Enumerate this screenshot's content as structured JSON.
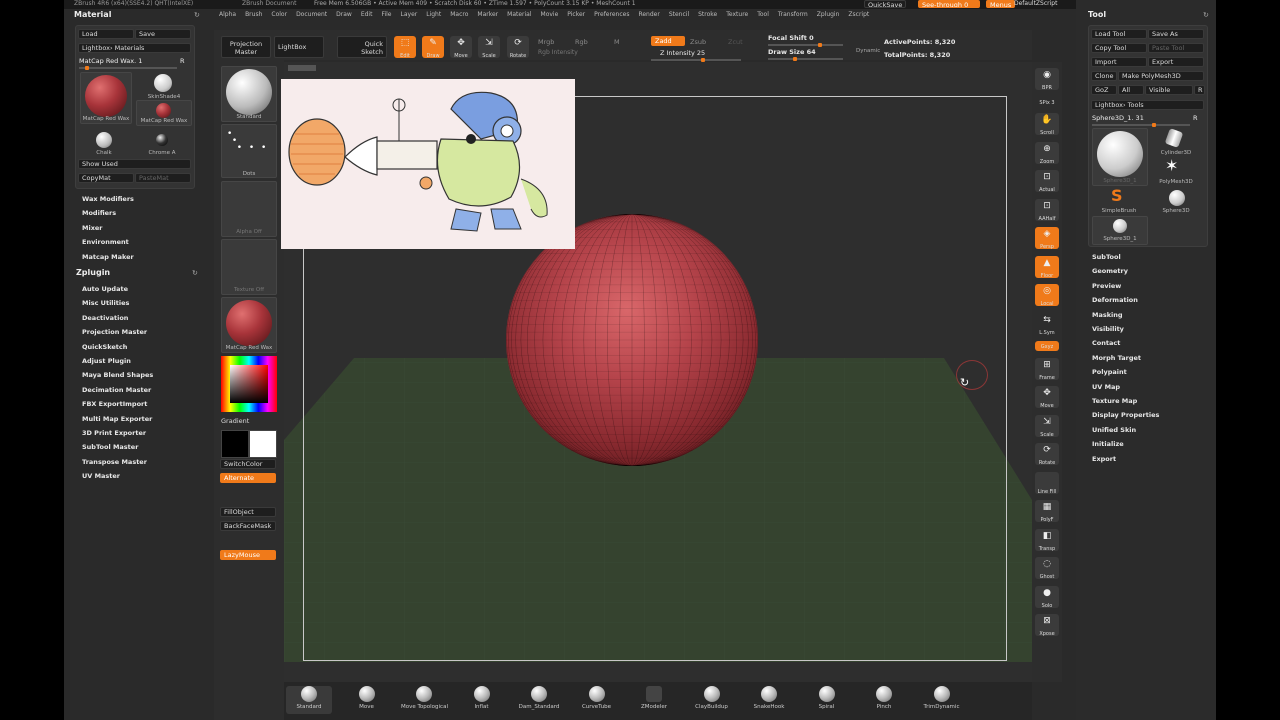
{
  "window": {
    "title_left": "ZBrush 4R6 (x64)(SSE4.2) QHT(IntelXE)",
    "doc": "ZBrush Document",
    "stats": "Free Mem 6.506GB • Active Mem 409 • Scratch Disk 60 • ZTime 1.597 • PolyCount 3.15 KP • MeshCount 1",
    "quicksave": "QuickSave",
    "see_through": "See-through 0",
    "menus": "Menus",
    "script": "DefaultZScript"
  },
  "menubar": [
    "Alpha",
    "Brush",
    "Color",
    "Document",
    "Draw",
    "Edit",
    "File",
    "Layer",
    "Light",
    "Macro",
    "Marker",
    "Material",
    "Movie",
    "Picker",
    "Preferences",
    "Render",
    "Stencil",
    "Stroke",
    "Texture",
    "Tool",
    "Transform",
    "Zplugin",
    "Zscript"
  ],
  "material_panel": {
    "title": "Material",
    "load": "Load",
    "save": "Save",
    "lightbox": "Lightbox› Materials",
    "current": "MatCap Red Wax. 1",
    "r": "R",
    "mat1": "MatCap Red Wax",
    "mat2": "SkinShade4",
    "mat3": "MatCap Red Wax",
    "mat4": "Chalk",
    "mat5": "Chrome A",
    "show_used": "Show Used",
    "copy": "CopyMat",
    "paste": "PasteMat"
  },
  "left_menu": [
    "Wax Modifiers",
    "Modifiers",
    "Mixer",
    "Environment",
    "Matcap Maker"
  ],
  "zplugin": {
    "title": "Zplugin",
    "items": [
      "Auto Update",
      "Misc Utilities",
      "Deactivation",
      "Projection Master",
      "QuickSketch",
      "Adjust Plugin",
      "Maya Blend Shapes",
      "Decimation Master",
      "FBX ExportImport",
      "Multi Map Exporter",
      "3D Print Exporter",
      "SubTool Master",
      "Transpose Master",
      "UV Master"
    ]
  },
  "left_shelf": {
    "standard": "Standard",
    "dots": "Dots",
    "alpha": "Alpha Off",
    "texture": "Texture Off",
    "material": "MatCap Red Wax",
    "gradient": "Gradient",
    "switch": "SwitchColor",
    "alternate": "Alternate",
    "fill": "FillObject",
    "backface": "BackFaceMask",
    "lazy": "LazyMouse"
  },
  "top_shelf": {
    "projection": "Projection Master",
    "lightbox": "LightBox",
    "quick": "Quick Sketch",
    "edit": "Edit",
    "draw": "Draw",
    "move": "Move",
    "scale": "Scale",
    "rotate": "Rotate",
    "mrgb": "Mrgb",
    "rgb": "Rgb",
    "m": "M",
    "rgb_intensity": "Rgb Intensity",
    "zadd": "Zadd",
    "zsub": "Zsub",
    "zcut": "Zcut",
    "z_intensity": "Z Intensity",
    "z_intensity_val": "25",
    "focal": "Focal Shift",
    "focal_val": "0",
    "draw_size": "Draw Size",
    "draw_size_val": "64",
    "dynamic": "Dynamic",
    "active_points": "ActivePoints: 8,320",
    "total_points": "TotalPoints: 8,320"
  },
  "right_shelf": [
    "BPR",
    "SPix 3",
    "Scroll",
    "Zoom",
    "Actual",
    "AAHalf",
    "Persp",
    "Floor",
    "Local",
    "L.Sym",
    "Gxyz",
    "Frame",
    "Move",
    "Scale",
    "Rotate",
    "Line Fill",
    "PolyF",
    "Transp",
    "Ghost",
    "Solo",
    "Xpose"
  ],
  "tool_panel": {
    "title": "Tool",
    "load": "Load Tool",
    "save": "Save As",
    "copy": "Copy Tool",
    "paste": "Paste Tool",
    "import": "Import",
    "export": "Export",
    "clone": "Clone",
    "make": "Make PolyMesh3D",
    "goz": "GoZ",
    "all": "All",
    "visible": "Visible",
    "r": "R",
    "lightbox": "Lightbox› Tools",
    "current": "Sphere3D_1. 31",
    "r2": "R",
    "t1": "Sphere3D_1",
    "t2": "Cylinder3D",
    "t3": "PolyMesh3D",
    "t4": "SimpleBrush",
    "t5": "Sphere3D",
    "t6": "Sphere3D_1"
  },
  "tool_menu": [
    "SubTool",
    "Geometry",
    "Preview",
    "Deformation",
    "Masking",
    "Visibility",
    "Contact",
    "Morph Target",
    "Polypaint",
    "UV Map",
    "Texture Map",
    "Display Properties",
    "Unified Skin",
    "Initialize",
    "Export"
  ],
  "brushes": [
    "Standard",
    "Move",
    "Move Topological",
    "Inflat",
    "Dam_Standard",
    "CurveTube",
    "ZModeler",
    "ClayBuildup",
    "SnakeHook",
    "Spiral",
    "Pinch",
    "TrimDynamic"
  ],
  "colors": {
    "accent": "#f07a1a",
    "bg": "#2a2a2a",
    "sphere": "#a8343a"
  }
}
